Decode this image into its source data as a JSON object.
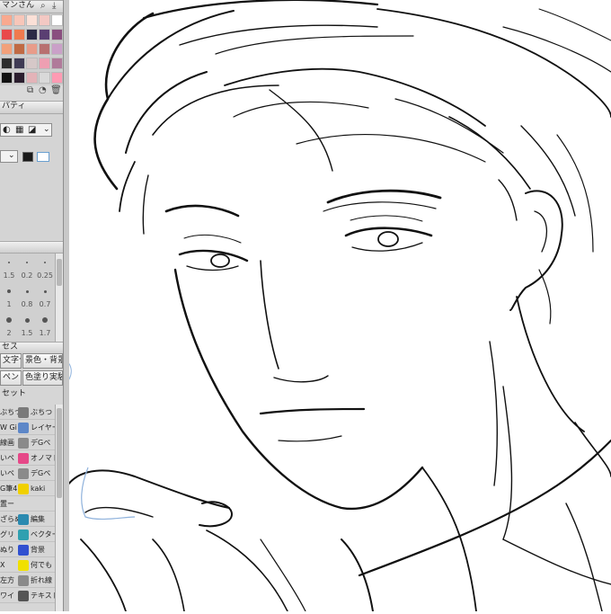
{
  "palette": {
    "title": "マンさん",
    "colors": [
      "#f9a98f",
      "#f7c6b9",
      "#fbe0d7",
      "#f3c8c3",
      "#ffffff",
      "#e9494b",
      "#f07a4e",
      "#2b2a45",
      "#5a3f72",
      "#8a4f7f",
      "#f2a07a",
      "#c06a44",
      "#e89c8a",
      "#b87070",
      "#caa0c8",
      "#2d2d2d",
      "#3f3b54",
      "#d6c8c8",
      "#ee9fb2",
      "#b07a9a",
      "#111111",
      "#2b1e2e",
      "#e3b3b8",
      "#d9d9d9",
      "#ff9bb3"
    ],
    "icons": [
      "search-icon",
      "save-icon",
      "copy-icon",
      "shape-icon",
      "trash-icon"
    ]
  },
  "properties": {
    "title": "パティ",
    "swatch_main": "#1a1a1a",
    "swatch_sub": "#ffffff"
  },
  "brush_size": {
    "values": [
      "1.5",
      "0.2",
      "0.25",
      "1",
      "0.8",
      "0.7",
      "2",
      "1.5",
      "1.7"
    ]
  },
  "subtool": {
    "title": "セス",
    "buttons": [
      "文字セ",
      "景色・背景",
      "ペン",
      "色塗り実験"
    ],
    "group_label": "セット",
    "rows": [
      {
        "left": "ぶちつ",
        "right": "ぶちつ",
        "ci": "#6fa4d8",
        "cr": "#7a7a7a"
      },
      {
        "left": "W Gi",
        "right": "レイヤー",
        "ci": "#9a9a9a",
        "cr": "#5d87c8"
      },
      {
        "left": "線画",
        "right": "デGペ",
        "ci": "#a8a8a8",
        "cr": "#8a8a8a"
      },
      {
        "left": "いペ",
        "right": "オノマト",
        "ci": "#9a9a9a",
        "cr": "#e64888"
      },
      {
        "left": "いペ",
        "right": "デGペ",
        "ci": "#8f8f8f",
        "cr": "#8a8a8a"
      },
      {
        "left": "G筆4",
        "right": "kaki",
        "ci": "#e8b800",
        "cr": "#f0d000"
      },
      {
        "left": "置ー",
        "right": "",
        "ci": "#9a9a9a",
        "cr": ""
      },
      {
        "left": "ざらめ",
        "right": "編集",
        "ci": "#c85050",
        "cr": "#2b8ab0"
      },
      {
        "left": "グリ",
        "right": "ベクター",
        "ci": "#5090c8",
        "cr": "#30a0b0"
      },
      {
        "left": "ぬり",
        "right": "背景",
        "ci": "#3060c8",
        "cr": "#3050d0"
      },
      {
        "left": "X",
        "right": "何でも",
        "ci": "#c83030",
        "cr": "#f0e000"
      },
      {
        "left": "左方",
        "right": "折れ線",
        "ci": "#a0a0a0",
        "cr": "#8a8a8a"
      },
      {
        "left": "ワイ",
        "right": "テキスト",
        "ci": "#909090",
        "cr": "#555555"
      }
    ]
  },
  "canvas": {
    "description_none": ""
  }
}
